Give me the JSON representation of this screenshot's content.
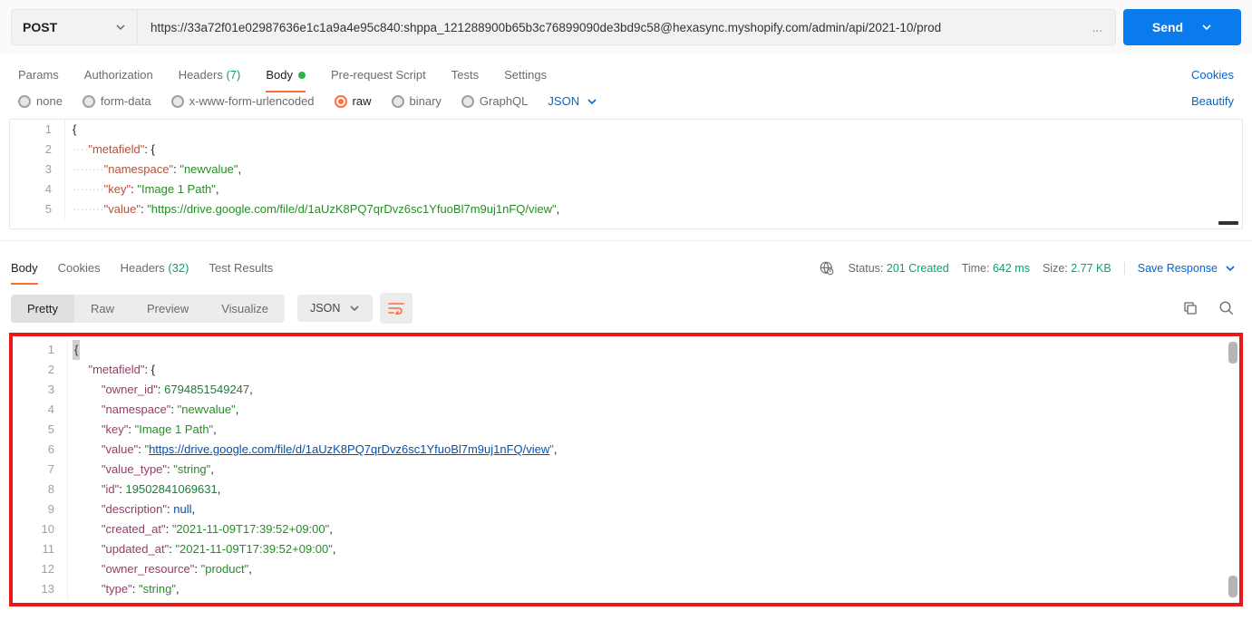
{
  "request": {
    "method": "POST",
    "url": "https://33a72f01e02987636e1c1a9a4e95c840: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@hexasync.myshopify.com/admin/api/2021-10/prod",
    "url_ellipsis": "...",
    "send_label": "Send"
  },
  "tabs": {
    "params": "Params",
    "auth": "Authorization",
    "headers_label": "Headers",
    "headers_count": "(7)",
    "body": "Body",
    "prescript": "Pre-request Script",
    "tests": "Tests",
    "settings": "Settings",
    "cookies": "Cookies"
  },
  "body_radio": {
    "none": "none",
    "formdata": "form-data",
    "urlenc": "x-www-form-urlencoded",
    "raw": "raw",
    "binary": "binary",
    "graphql": "GraphQL",
    "json": "JSON",
    "beautify": "Beautify"
  },
  "req_body": {
    "l1": "{",
    "l2_prop": "\"metafield\"",
    "l2_rest": ": {",
    "l3_prop": "\"namespace\"",
    "l3_val": "\"newvalue\"",
    "l4_prop": "\"key\"",
    "l4_val": "\"Image 1 Path\"",
    "l5_prop": "\"value\"",
    "l5_val": "\"https://drive.google.com/file/d/1aUzK8PQ7qrDvz6sc1YfuoBl7m9uj1nFQ/view\""
  },
  "resp_tabs": {
    "body": "Body",
    "cookies": "Cookies",
    "headers_label": "Headers",
    "headers_count": "(32)",
    "tests": "Test Results"
  },
  "status": {
    "status_label": "Status:",
    "status_val": "201 Created",
    "time_label": "Time:",
    "time_val": "642 ms",
    "size_label": "Size:",
    "size_val": "2.77 KB",
    "save": "Save Response"
  },
  "viewer": {
    "pretty": "Pretty",
    "raw": "Raw",
    "preview": "Preview",
    "visualize": "Visualize",
    "json": "JSON"
  },
  "resp_body": {
    "l1": "{",
    "l2_prop": "\"metafield\"",
    "l2_rest": ": {",
    "l3_prop": "\"owner_id\"",
    "l3_val": "6794851549247",
    "l4_prop": "\"namespace\"",
    "l4_val": "\"newvalue\"",
    "l5_prop": "\"key\"",
    "l5_val": "\"Image 1 Path\"",
    "l6_prop": "\"value\"",
    "l6_q": "\"",
    "l6_link": "https://drive.google.com/file/d/1aUzK8PQ7qrDvz6sc1YfuoBl7m9uj1nFQ/view",
    "l7_prop": "\"value_type\"",
    "l7_val": "\"string\"",
    "l8_prop": "\"id\"",
    "l8_val": "19502841069631",
    "l9_prop": "\"description\"",
    "l9_val": "null",
    "l10_prop": "\"created_at\"",
    "l10_val": "\"2021-11-09T17:39:52+09:00\"",
    "l11_prop": "\"updated_at\"",
    "l11_val": "\"2021-11-09T17:39:52+09:00\"",
    "l12_prop": "\"owner_resource\"",
    "l12_val": "\"product\"",
    "l13_prop": "\"type\"",
    "l13_val": "\"string\""
  },
  "line_nums": {
    "n1": "1",
    "n2": "2",
    "n3": "3",
    "n4": "4",
    "n5": "5",
    "n6": "6",
    "n7": "7",
    "n8": "8",
    "n9": "9",
    "n10": "10",
    "n11": "11",
    "n12": "12",
    "n13": "13"
  }
}
